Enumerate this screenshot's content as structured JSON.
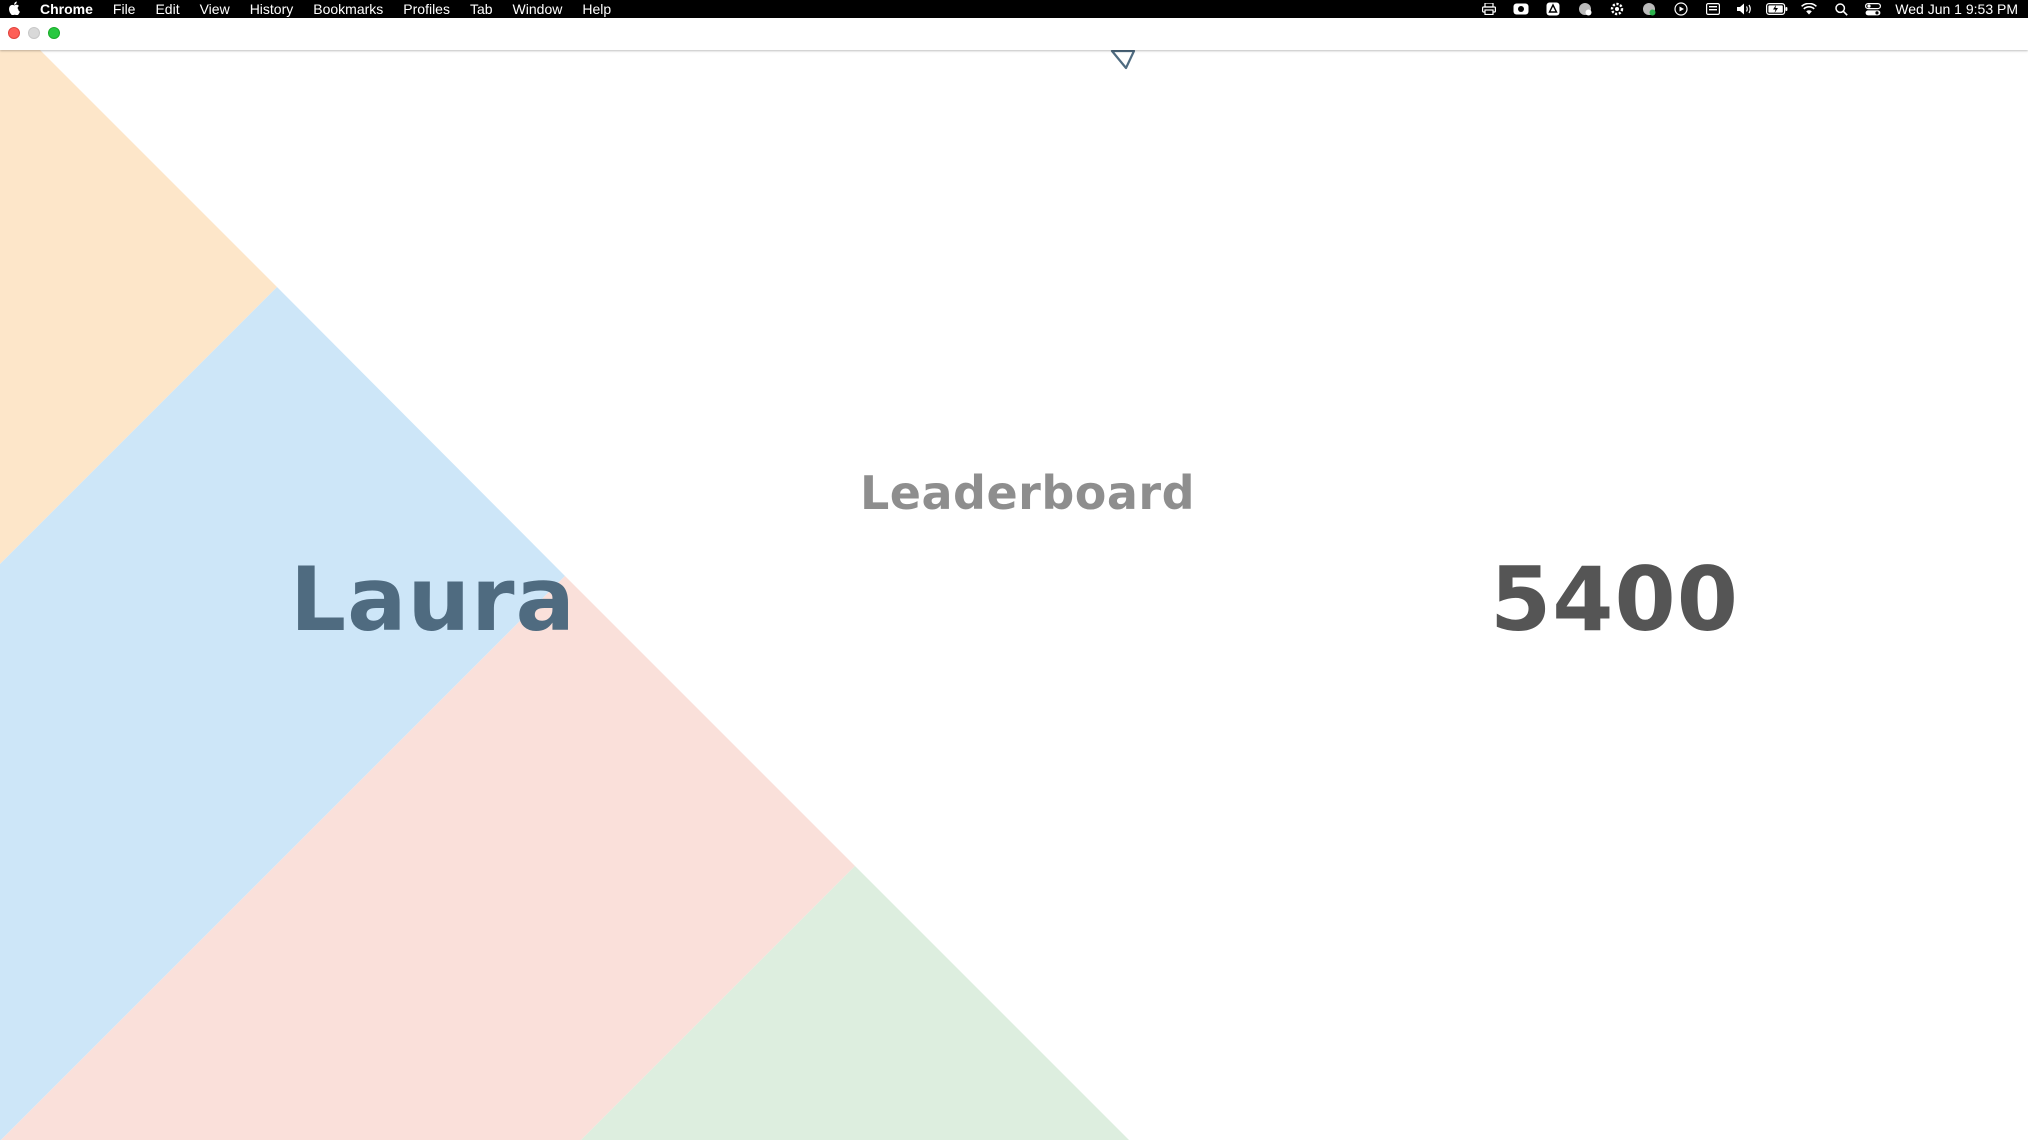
{
  "menubar": {
    "app_name": "Chrome",
    "menus": [
      "File",
      "Edit",
      "View",
      "History",
      "Bookmarks",
      "Profiles",
      "Tab",
      "Window",
      "Help"
    ],
    "status_icons": [
      "printer-icon",
      "camera-icon",
      "drive-icon",
      "globe-icon",
      "gear-icon",
      "network-icon",
      "play-icon",
      "keyboard-icon",
      "volume-icon",
      "battery-icon",
      "wifi-icon",
      "search-icon",
      "control-center-icon"
    ],
    "clock": "Wed Jun 1  9:53 PM"
  },
  "window": {
    "controls": [
      "close",
      "minimize",
      "maximize"
    ]
  },
  "page": {
    "title": "Leaderboard",
    "entry": {
      "name": "Laura",
      "score": "5400"
    }
  },
  "colors": {
    "orange_band": "#fde6c9",
    "blue_band": "#cde6f8",
    "red_band": "#fae0da",
    "green_band": "#ddeedf",
    "title_text": "#8e8e8e",
    "name_text": "#4f6b80",
    "score_text": "#555555"
  }
}
